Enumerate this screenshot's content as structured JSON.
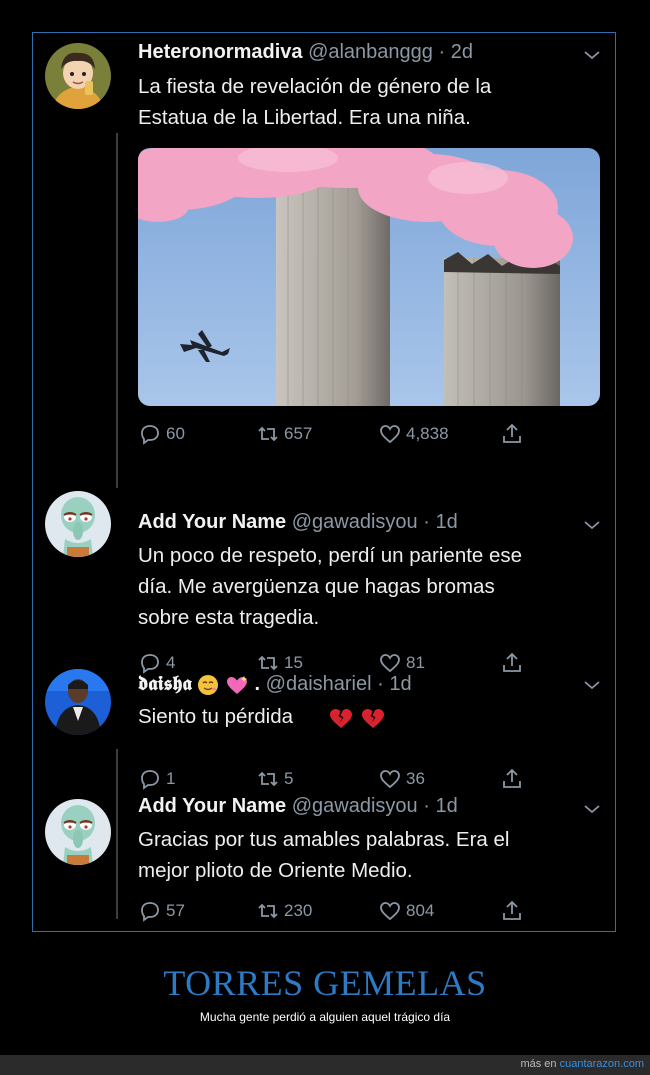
{
  "tweets": [
    {
      "name": "Heteronormadiva",
      "handle": "@alanbanggg",
      "time": "2d",
      "text_lines": [
        "La fiesta de revelación de género de la",
        "Estatua de la Libertad. Era una niña."
      ],
      "replies": "60",
      "retweets": "657",
      "likes": "4,838"
    },
    {
      "name": "Add Your Name",
      "handle": "@gawadisyou",
      "time": "1d",
      "text_lines": [
        "Un poco de respeto, perdí un pariente ese",
        "día. Me avergüenza que hagas bromas",
        "sobre esta tragedia."
      ],
      "replies": "4",
      "retweets": "15",
      "likes": "81"
    },
    {
      "name": "𝖉𝖆𝖎𝖘𝖍𝖆",
      "name_suffix": ".",
      "handle": "@daishariel",
      "time": "1d",
      "text_lines": [
        "Siento tu pérdida"
      ],
      "replies": "1",
      "retweets": "5",
      "likes": "36"
    },
    {
      "name": "Add Your Name",
      "handle": "@gawadisyou",
      "time": "1d",
      "text_lines": [
        "Gracias por tus amables palabras. Era el",
        "mejor plioto de Oriente Medio."
      ],
      "replies": "57",
      "retweets": "230",
      "likes": "804"
    }
  ],
  "caption": {
    "title": "TORRES GEMELAS",
    "subtitle": "Mucha gente perdió a alguien aquel trágico día"
  },
  "footer": {
    "prefix": "más en ",
    "site": "cuantarazon.com"
  },
  "icons": {
    "reply": "reply-icon",
    "retweet": "retweet-icon",
    "like": "heart-icon",
    "share": "share-icon",
    "more": "chevron-down-icon"
  },
  "colors": {
    "background": "#000000",
    "frame_border": "#2f6fae",
    "muted": "#8b98a5",
    "title_blue": "#2c7bc4"
  }
}
